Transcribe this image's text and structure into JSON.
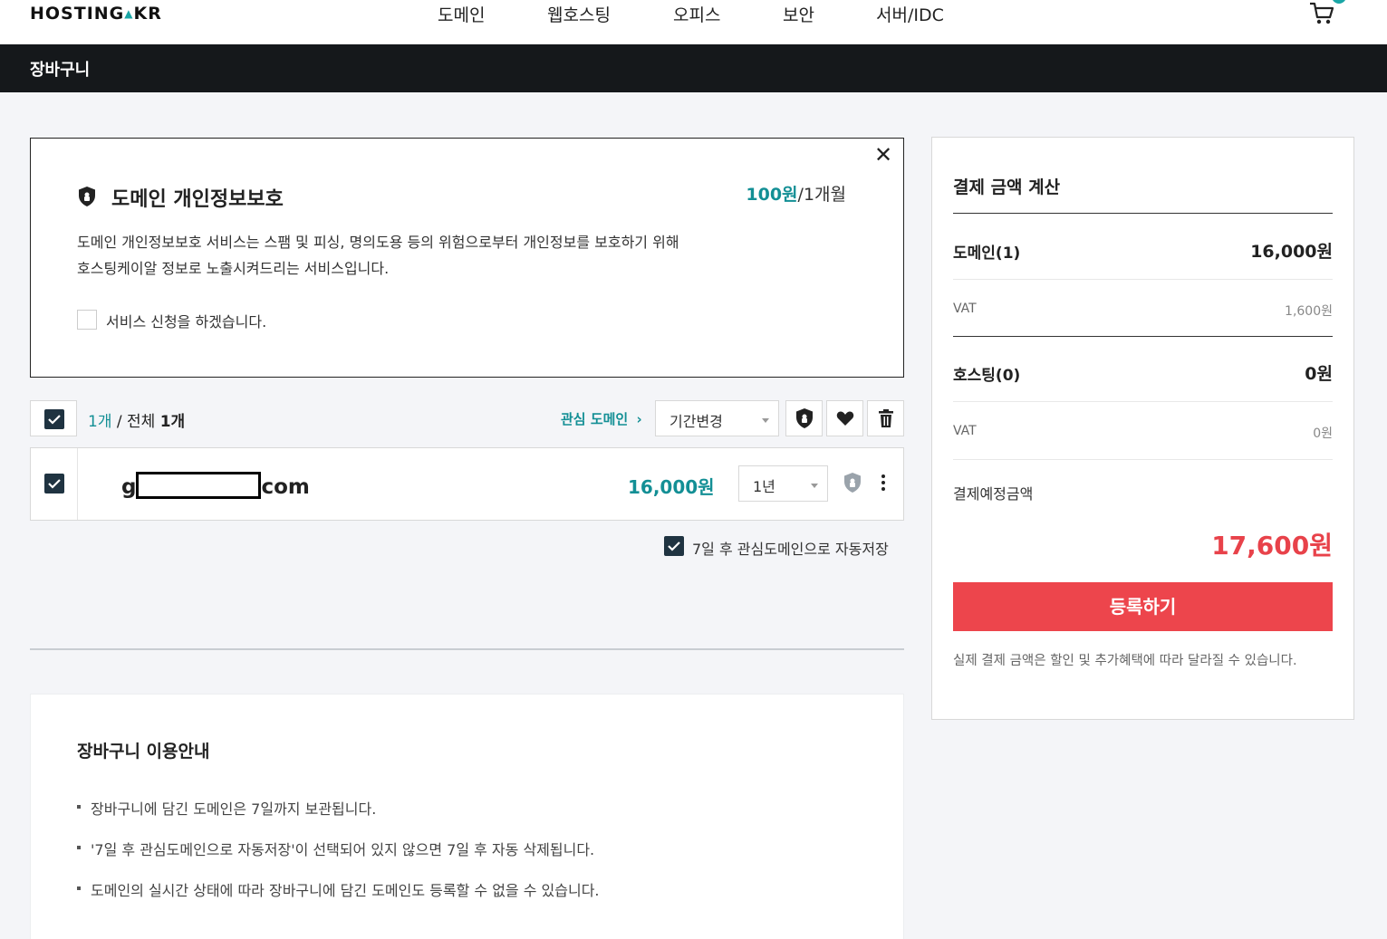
{
  "header": {
    "logo": "HOSTING",
    "logo_tld": "KR",
    "nav": [
      {
        "label": "도메인"
      },
      {
        "label": "웹호스팅"
      },
      {
        "label": "오피스"
      },
      {
        "label": "보안"
      },
      {
        "label": "서버/IDC"
      }
    ]
  },
  "titlebar": {
    "title": "장바구니"
  },
  "privacy": {
    "title": "도메인 개인정보보호",
    "price_amount": "100원",
    "price_period": "/1개월",
    "desc_line1": "도메인 개인정보보호 서비스는 스팸 및 피싱, 명의도용 등의 위험으로부터 개인정보를 보호하기 위해",
    "desc_line2": "호스팅케이알 정보로 노출시켜드리는 서비스입니다.",
    "checkbox_label": "서비스 신청을 하겠습니다."
  },
  "toolbar": {
    "selected_count": "1개",
    "separator": " / 전체 ",
    "total_count": "1개",
    "fav_link": "관심 도메인",
    "period_select": "기간변경"
  },
  "domain_row": {
    "name_prefix": "g",
    "name_suffix": "com",
    "price": "16,000원",
    "period": "1년"
  },
  "auto_save_label": "7일 후 관심도메인으로 자동저장",
  "guide": {
    "title": "장바구니 이용안내",
    "items": [
      "장바구니에 담긴 도메인은 7일까지 보관됩니다.",
      "'7일 후 관심도메인으로 자동저장'이 선택되어 있지 않으면 7일 후 자동 삭제됩니다.",
      "도메인의 실시간 상태에 따라 장바구니에 담긴 도메인도 등록할 수 없을 수 있습니다."
    ]
  },
  "summary": {
    "title": "결제 금액 계산",
    "domain_label": "도메인(1)",
    "domain_amount": "16,000원",
    "domain_vat_label": "VAT",
    "domain_vat": "1,600원",
    "hosting_label": "호스팅(0)",
    "hosting_amount": "0원",
    "hosting_vat_label": "VAT",
    "hosting_vat": "0원",
    "total_label": "결제예정금액",
    "total_amount": "17,600원",
    "register_button": "등록하기",
    "note": "실제 결제 금액은 할인 및 추가혜택에 따라 달라질 수 있습니다."
  },
  "colors": {
    "accent": "#138f95",
    "danger": "#ed454c",
    "dark": "#15181b"
  }
}
